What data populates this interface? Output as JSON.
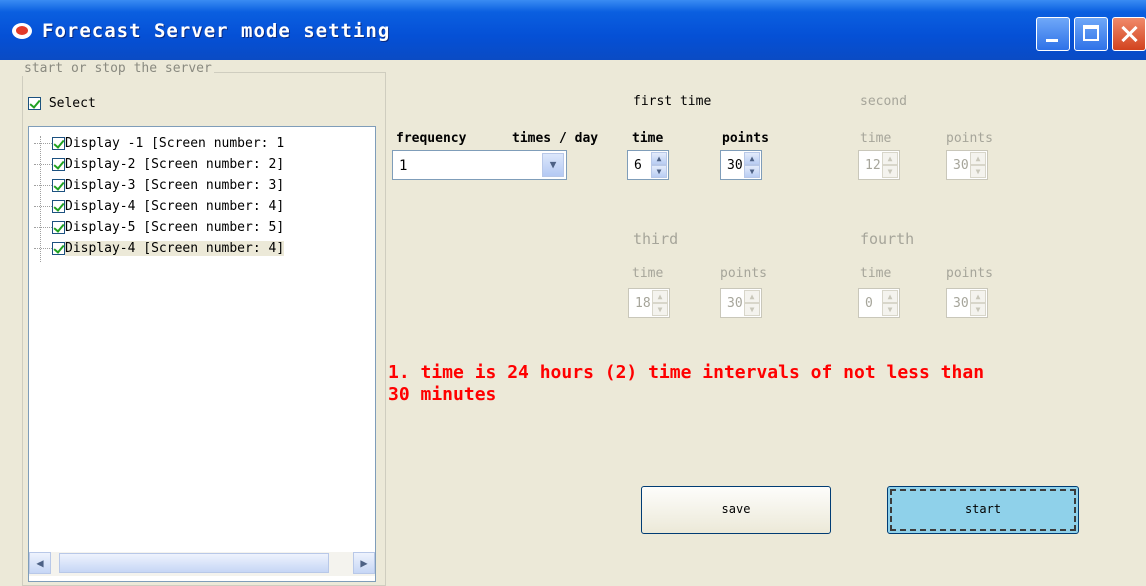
{
  "window": {
    "title": "Forecast Server mode setting"
  },
  "left_panel": {
    "group_title": "start or stop the server",
    "select_label": "Select",
    "select_checked": true,
    "displays": [
      {
        "label": "Display -1 [Screen number: 1",
        "checked": true
      },
      {
        "label": "Display-2 [Screen number: 2]",
        "checked": true
      },
      {
        "label": "Display-3 [Screen number: 3]",
        "checked": true
      },
      {
        "label": "Display-4 [Screen number: 4]",
        "checked": true
      },
      {
        "label": "Display-5 [Screen number: 5]",
        "checked": true
      },
      {
        "label": "Display-4 [Screen number: 4]",
        "checked": true
      }
    ]
  },
  "settings": {
    "frequency_label": "frequency",
    "times_per_day_label": "times / day",
    "frequency_value": "1",
    "first": {
      "heading": "first time",
      "time_label": "time",
      "points_label": "points",
      "time": "6",
      "points": "30"
    },
    "second": {
      "heading": "second",
      "time_label": "time",
      "points_label": "points",
      "time": "12",
      "points": "30"
    },
    "third": {
      "heading": "third",
      "time_label": "time",
      "points_label": "points",
      "time": "18",
      "points": "30"
    },
    "fourth": {
      "heading": "fourth",
      "time_label": "time",
      "points_label": "points",
      "time": "0",
      "points": "30"
    }
  },
  "note": {
    "line1": "1. time is 24 hours (2) time intervals of not less than",
    "line2": "30 minutes",
    "color": "#ff0000"
  },
  "buttons": {
    "save": "save",
    "start": "start"
  }
}
